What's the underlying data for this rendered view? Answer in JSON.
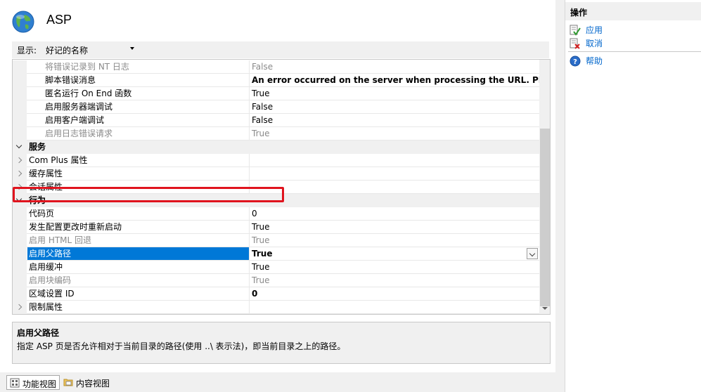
{
  "header": {
    "title": "ASP",
    "icon": "globe-icon"
  },
  "toolbar": {
    "display_label": "显示:",
    "display_value": "好记的名称"
  },
  "grid": {
    "rows": [
      {
        "name": "将错误记录到 NT 日志",
        "value": "False",
        "type": "prop",
        "gray": true
      },
      {
        "name": "脚本错误消息",
        "value": "An error occurred on the server when processing the URL. Please c",
        "type": "prop",
        "bold": true
      },
      {
        "name": "匿名运行 On End 函数",
        "value": "True",
        "type": "prop"
      },
      {
        "name": "启用服务器端调试",
        "value": "False",
        "type": "prop"
      },
      {
        "name": "启用客户端调试",
        "value": "False",
        "type": "prop"
      },
      {
        "name": "启用日志错误请求",
        "value": "True",
        "type": "prop",
        "gray": true
      },
      {
        "name": "服务",
        "value": "",
        "type": "category"
      },
      {
        "name": "Com Plus 属性",
        "value": "",
        "type": "collapsed"
      },
      {
        "name": "缓存属性",
        "value": "",
        "type": "collapsed"
      },
      {
        "name": "会话属性",
        "value": "",
        "type": "collapsed"
      },
      {
        "name": "行为",
        "value": "",
        "type": "category"
      },
      {
        "name": "代码页",
        "value": "0",
        "type": "prop2"
      },
      {
        "name": "发生配置更改时重新启动",
        "value": "True",
        "type": "prop2"
      },
      {
        "name": "启用 HTML 回退",
        "value": "True",
        "type": "prop2",
        "gray": true
      },
      {
        "name": "启用父路径",
        "value": "True",
        "type": "prop2",
        "selected": true
      },
      {
        "name": "启用缓冲",
        "value": "True",
        "type": "prop2"
      },
      {
        "name": "启用块编码",
        "value": "True",
        "type": "prop2",
        "gray": true
      },
      {
        "name": "区域设置 ID",
        "value": "0",
        "type": "prop2",
        "bold": true
      },
      {
        "name": "限制属性",
        "value": "",
        "type": "collapsed"
      }
    ]
  },
  "description": {
    "title": "启用父路径",
    "text": "指定 ASP 页是否允许相对于当前目录的路径(使用 ..\\ 表示法)，即当前目录之上的路径。"
  },
  "bottom_tabs": {
    "features": "功能视图",
    "content": "内容视图"
  },
  "actions": {
    "header": "操作",
    "apply": "应用",
    "cancel": "取消",
    "help": "帮助"
  },
  "colors": {
    "selection": "#0078d7",
    "highlight_box": "#e0141e",
    "link": "#0066cc"
  }
}
